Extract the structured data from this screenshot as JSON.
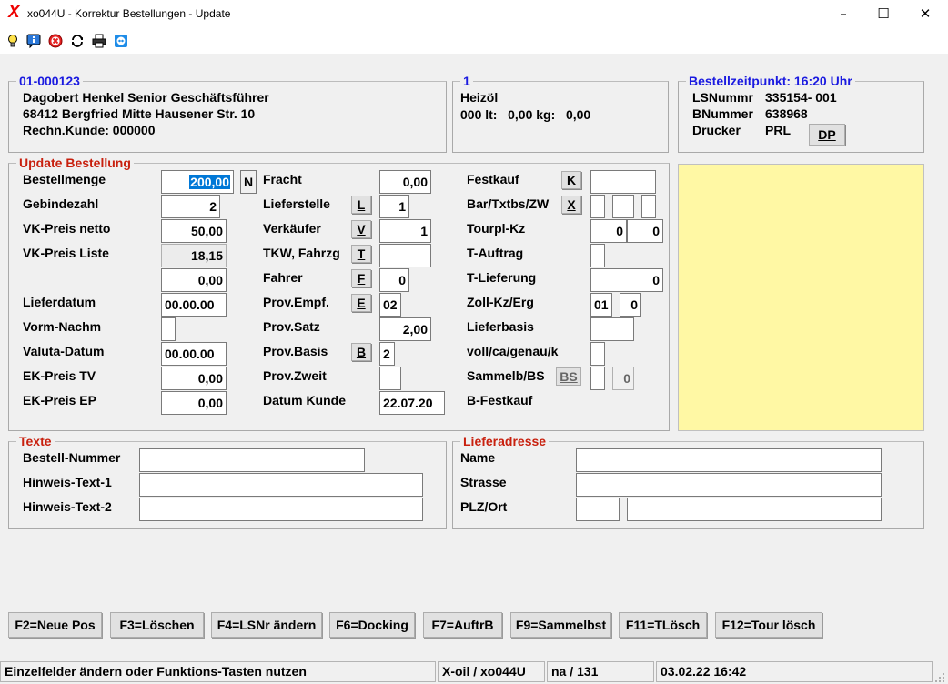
{
  "window": {
    "title": "xo044U - Korrektur Bestellungen - Update",
    "app_icon": "X",
    "minimize": "–",
    "maximize": "☐",
    "close": "✕"
  },
  "toolbar": {
    "icons": [
      "bulb-icon",
      "info-icon",
      "cancel-icon",
      "refresh-icon",
      "print-icon",
      "teamviewer-icon"
    ]
  },
  "customer": {
    "id": "01-000123",
    "name": "Dagobert Henkel Senior Geschäftsführer",
    "address": "68412 Bergfried Mitte Hausener Str. 10",
    "invoice_customer": "Rechn.Kunde: 000000"
  },
  "product": {
    "number": "1",
    "name": "Heizöl",
    "quantity_line": "000 lt:   0,00 kg:   0,00"
  },
  "order_time": {
    "title": "Bestellzeitpunkt: 16:20 Uhr",
    "ls_label": "LSNummr",
    "ls_value": "335154- 001",
    "b_label": "BNummer",
    "b_value": "638968",
    "printer_label": "Drucker",
    "printer_value": "PRL",
    "dp_button": "DP"
  },
  "update": {
    "title": "Update Bestellung",
    "col1": {
      "bestellmenge_label": "Bestellmenge",
      "bestellmenge_value": "200,00",
      "n_button": "N",
      "gebindezahl_label": "Gebindezahl",
      "gebindezahl_value": "2",
      "vk_netto_label": "VK-Preis netto",
      "vk_netto_value": "50,00",
      "vk_liste_label": "VK-Preis Liste",
      "vk_liste_value": "18,15",
      "extra_value": "0,00",
      "lieferdatum_label": "Lieferdatum",
      "lieferdatum_value": "00.00.00",
      "vorm_nachm_label": "Vorm-Nachm",
      "vorm_nachm_value": "",
      "valuta_label": "Valuta-Datum",
      "valuta_value": "00.00.00",
      "ek_tv_label": "EK-Preis TV",
      "ek_tv_value": "0,00",
      "ek_ep_label": "EK-Preis EP",
      "ek_ep_value": "0,00"
    },
    "col2": {
      "fracht_label": "Fracht",
      "fracht_value": "0,00",
      "lieferstelle_label": "Lieferstelle",
      "lieferstelle_btn": "L",
      "lieferstelle_value": "1",
      "verkaeufer_label": "Verkäufer",
      "verkaeufer_btn": "V",
      "verkaeufer_value": "1",
      "tkw_label": "TKW, Fahrzg",
      "tkw_btn": "T",
      "tkw_value": "",
      "fahrer_label": "Fahrer",
      "fahrer_btn": "F",
      "fahrer_value": "0",
      "prov_empf_label": "Prov.Empf.",
      "prov_empf_btn": "E",
      "prov_empf_value": "02",
      "prov_satz_label": "Prov.Satz",
      "prov_satz_value": "2,00",
      "prov_basis_label": "Prov.Basis",
      "prov_basis_btn": "B",
      "prov_basis_value": "2",
      "prov_zweit_label": "Prov.Zweit",
      "prov_zweit_value": "",
      "datum_kunde_label": "Datum Kunde",
      "datum_kunde_value": "22.07.20"
    },
    "col3": {
      "festkauf_label": "Festkauf",
      "festkauf_btn": "K",
      "festkauf_value": "",
      "bar_label": "Bar/Txtbs/ZW",
      "bar_btn": "X",
      "tourpl_label": "Tourpl-Kz",
      "tourpl_value1": "0",
      "tourpl_value2": "0",
      "t_auftrag_label": "T-Auftrag",
      "t_lieferung_label": "T-Lieferung",
      "t_lieferung_value": "0",
      "zoll_label": "Zoll-Kz/Erg",
      "zoll_value1": "01",
      "zoll_value2": "0",
      "lieferbasis_label": "Lieferbasis",
      "voll_label": "voll/ca/genau/k",
      "sammelb_label": "Sammelb/BS",
      "sammelb_btn": "BS",
      "sammelb_value": "0",
      "b_festkauf_label": "B-Festkauf"
    }
  },
  "texte": {
    "title": "Texte",
    "bestell_nummer_label": "Bestell-Nummer",
    "bestell_nummer_value": "",
    "hinweis1_label": "Hinweis-Text-1",
    "hinweis1_value": "",
    "hinweis2_label": "Hinweis-Text-2",
    "hinweis2_value": ""
  },
  "lieferadresse": {
    "title": "Lieferadresse",
    "name_label": "Name",
    "strasse_label": "Strasse",
    "plz_label": "PLZ/Ort"
  },
  "function_keys": [
    "F2=Neue Pos",
    "F3=Löschen",
    "F4=LSNr ändern",
    "F6=Docking",
    "F7=AuftrB",
    "F9=Sammelbst",
    "F11=TLösch",
    "F12=Tour lösch"
  ],
  "statusbar": {
    "message": "Einzelfelder ändern oder Funktions-Tasten nutzen",
    "program": "X-oil / xo044U",
    "user": "na / 131",
    "datetime": "03.02.22 16:42"
  }
}
